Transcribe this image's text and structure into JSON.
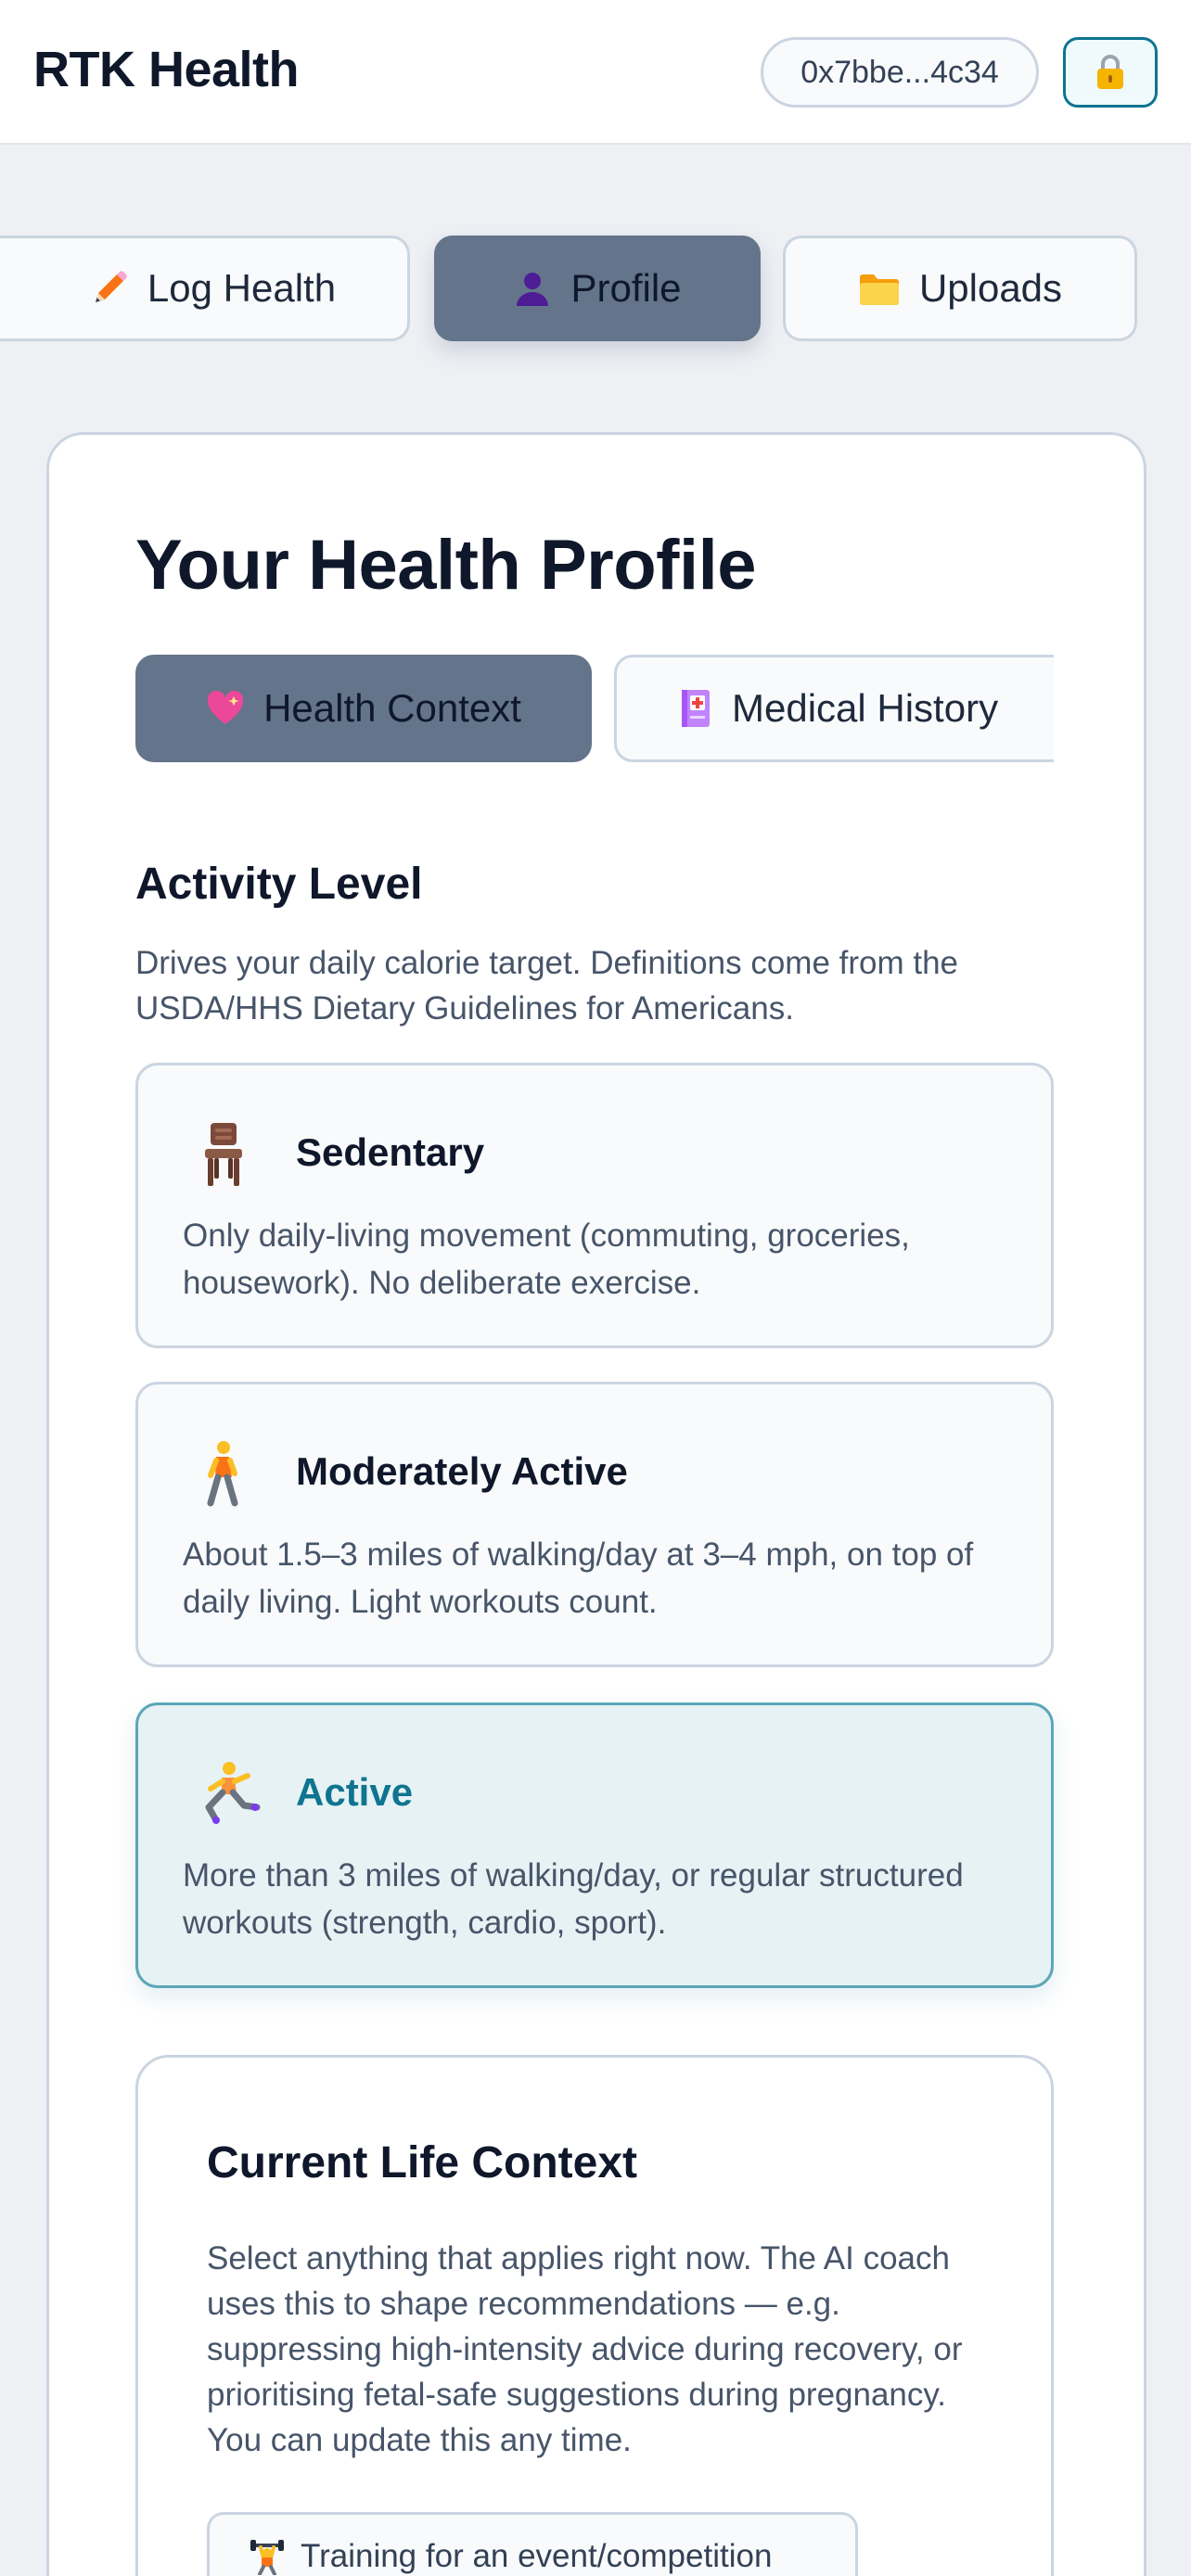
{
  "header": {
    "app_title": "RTK Health",
    "wallet_address": "0x7bbe...4c34",
    "lock_icon": "lock-icon"
  },
  "main_tabs": [
    {
      "label": "Log Health",
      "icon": "pencil-icon",
      "active": false
    },
    {
      "label": "Profile",
      "icon": "person-icon",
      "active": true
    },
    {
      "label": "Uploads",
      "icon": "folder-icon",
      "active": false
    }
  ],
  "profile": {
    "title": "Your Health Profile",
    "sub_tabs": [
      {
        "label": "Health Context",
        "icon": "heart-icon",
        "active": true
      },
      {
        "label": "Medical History",
        "icon": "medical-notebook-icon",
        "active": false
      }
    ],
    "activity": {
      "heading": "Activity Level",
      "description": "Drives your daily calorie target. Definitions come from the USDA/HHS Dietary Guidelines for Americans.",
      "options": [
        {
          "title": "Sedentary",
          "description": "Only daily-living movement (commuting, groceries, housework). No deliberate exercise.",
          "icon": "chair-icon",
          "selected": false
        },
        {
          "title": "Moderately Active",
          "description": "About 1.5–3 miles of walking/day at 3–4 mph, on top of daily living. Light workouts count.",
          "icon": "walking-person-icon",
          "selected": false
        },
        {
          "title": "Active",
          "description": "More than 3 miles of walking/day, or regular structured workouts (strength, cardio, sport).",
          "icon": "running-person-icon",
          "selected": true
        }
      ]
    },
    "life_context": {
      "heading": "Current Life Context",
      "description": "Select anything that applies right now. The AI coach uses this to shape recommendations — e.g. suppressing high-intensity advice during recovery, or prioritising fetal-safe suggestions during pregnancy. You can update this any time.",
      "chips": [
        {
          "label": "Training for an event/competition",
          "icon": "weightlifter-icon"
        }
      ]
    }
  },
  "colors": {
    "accent": "#0e7490",
    "active_tab": "#64748b",
    "selected_card": "#e6f2f4"
  }
}
